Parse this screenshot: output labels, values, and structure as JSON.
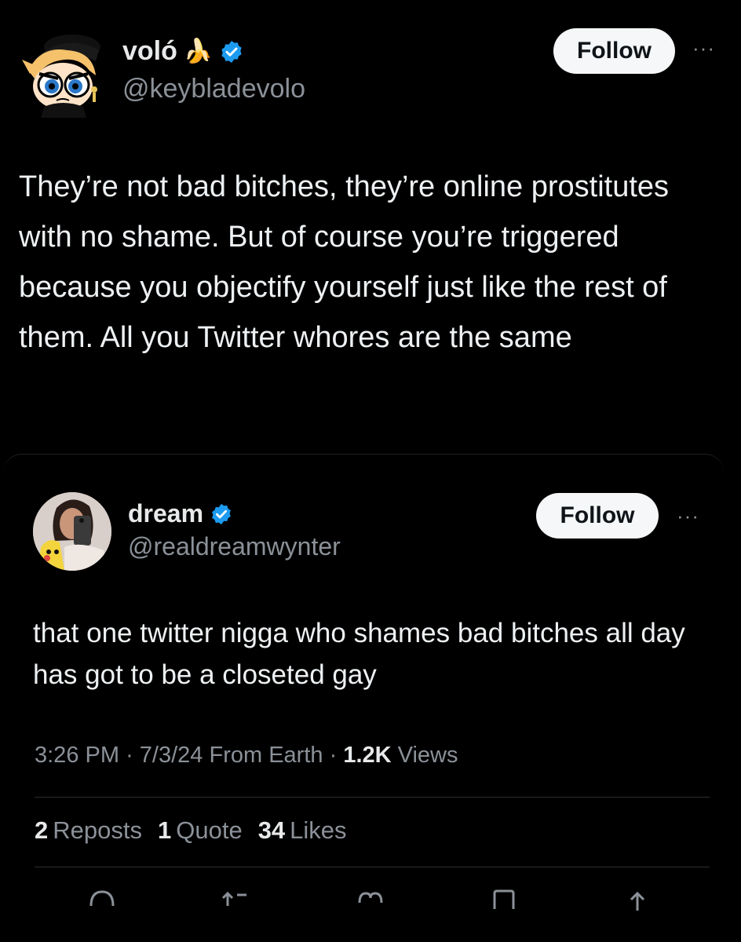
{
  "outer_tweet": {
    "display_name": "voló",
    "name_emoji": "🍌",
    "handle": "@keybladevolo",
    "follow_label": "Follow",
    "more_label": "···",
    "text": "They’re not bad bitches, they’re online prostitutes with no shame. But of course you’re triggered because you objectify yourself just like the rest of them. All you Twitter whores are the same"
  },
  "quoted_tweet": {
    "display_name": "dream",
    "handle": "@realdreamwynter",
    "follow_label": "Follow",
    "more_label": "···",
    "text": "that one twitter nigga who shames bad bitches all day has got to be a closeted gay",
    "time": "3:26 PM",
    "date": "7/3/24",
    "location": "From Earth",
    "views_count": "1.2K",
    "views_label": "Views",
    "separator": "·",
    "reposts_count": "2",
    "reposts_label": "Reposts",
    "quotes_count": "1",
    "quotes_label": "Quote",
    "likes_count": "34",
    "likes_label": "Likes"
  },
  "colors": {
    "background": "#000000",
    "verified_blue": "#1d9bf0",
    "muted_text": "#8b9198"
  },
  "icons": [
    "verified-badge-icon",
    "reply-icon",
    "repost-icon",
    "like-icon",
    "bookmark-icon",
    "share-icon"
  ]
}
